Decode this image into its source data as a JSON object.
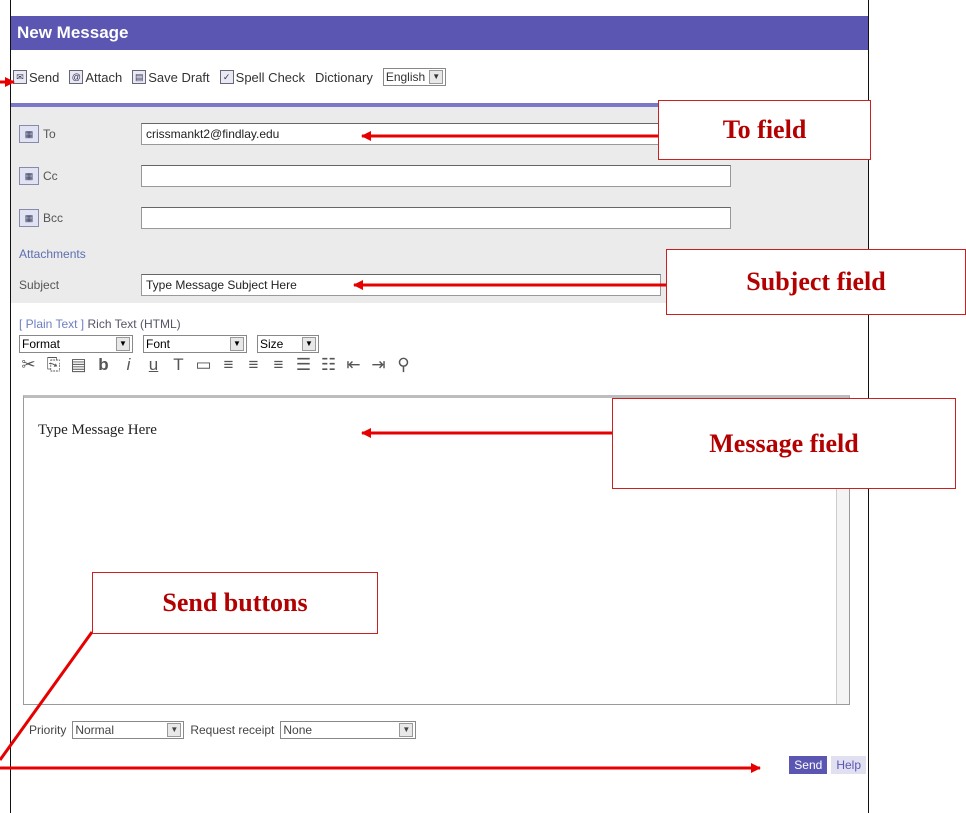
{
  "window": {
    "title": "New Message"
  },
  "toolbar": {
    "send_label": "Send",
    "attach_label": "Attach",
    "save_draft_label": "Save Draft",
    "spell_check_label": "Spell Check",
    "dictionary_label": "Dictionary",
    "dictionary_value": "English"
  },
  "header": {
    "to_label": "To",
    "to_value": "crissmankt2@findlay.edu",
    "cc_label": "Cc",
    "cc_value": "",
    "bcc_label": "Bcc",
    "bcc_value": "",
    "attachments_label": "Attachments",
    "subject_label": "Subject",
    "subject_value": "Type Message Subject Here"
  },
  "editor": {
    "mode_plain": "[ Plain Text ]",
    "mode_rich": "Rich Text (HTML)",
    "format_value": "Format",
    "font_value": "Font",
    "size_value": "Size",
    "body_text": "Type Message Here",
    "icons": [
      "cut-icon",
      "copy-icon",
      "paste-icon",
      "bold-icon",
      "italic-icon",
      "underline-icon",
      "text-color-icon",
      "highlight-icon",
      "align-left-icon",
      "align-center-icon",
      "align-right-icon",
      "numbered-list-icon",
      "bulleted-list-icon",
      "outdent-icon",
      "indent-icon",
      "find-icon"
    ]
  },
  "footer": {
    "priority_label": "Priority",
    "priority_value": "Normal",
    "receipt_label": "Request receipt",
    "receipt_value": "None",
    "send_label": "Send",
    "help_label": "Help"
  },
  "callouts": {
    "to_field": "To field",
    "subject_field": "Subject field",
    "message_field": "Message field",
    "send_buttons": "Send buttons"
  },
  "colors": {
    "title_bar": "#5b56b2",
    "annotation_red": "#cc1f1f"
  }
}
